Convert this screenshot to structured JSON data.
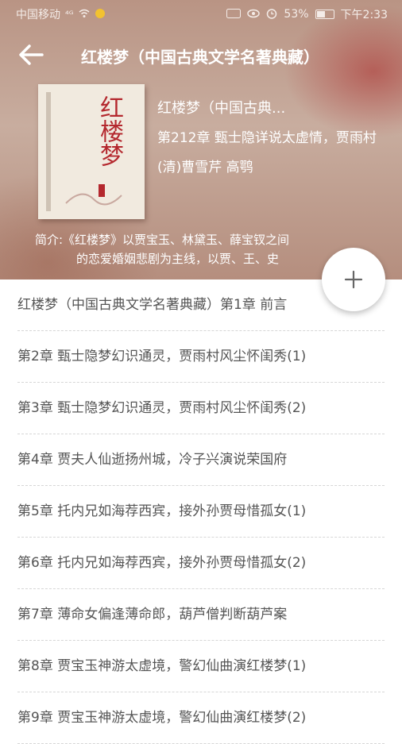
{
  "statusbar": {
    "carrier": "中国移动",
    "signal": "⁴ᴳ",
    "battery": "53%",
    "time": "下午2:33"
  },
  "toolbar": {
    "title": "红楼梦（中国古典文学名著典藏）"
  },
  "book": {
    "cover_title": "红楼梦",
    "name": "红楼梦（中国古典...",
    "latest_chapter": "第212章 甄士隐详说太虚情，贾雨村",
    "author": "(清)曹雪芹 高鹗",
    "synopsis_line1": "简介:《红楼梦》以贾宝玉、林黛玉、薛宝钗之间",
    "synopsis_line2": "的恋爱婚姻悲剧为主线，以贾、王、史"
  },
  "chapters": [
    "红楼梦（中国古典文学名著典藏）第1章 前言",
    "第2章 甄士隐梦幻识通灵，贾雨村风尘怀闺秀(1)",
    "第3章 甄士隐梦幻识通灵，贾雨村风尘怀闺秀(2)",
    "第4章 贾夫人仙逝扬州城，冷子兴演说荣国府",
    "第5章 托内兄如海荐西宾，接外孙贾母惜孤女(1)",
    "第6章 托内兄如海荐西宾，接外孙贾母惜孤女(2)",
    "第7章 薄命女偏逢薄命郎，葫芦僧判断葫芦案",
    "第8章 贾宝玉神游太虚境，警幻仙曲演红楼梦(1)",
    "第9章 贾宝玉神游太虚境，警幻仙曲演红楼梦(2)"
  ],
  "colors": {
    "header_bg": "#c0a090",
    "text_muted": "#555555",
    "divider": "#d6d6d6"
  }
}
